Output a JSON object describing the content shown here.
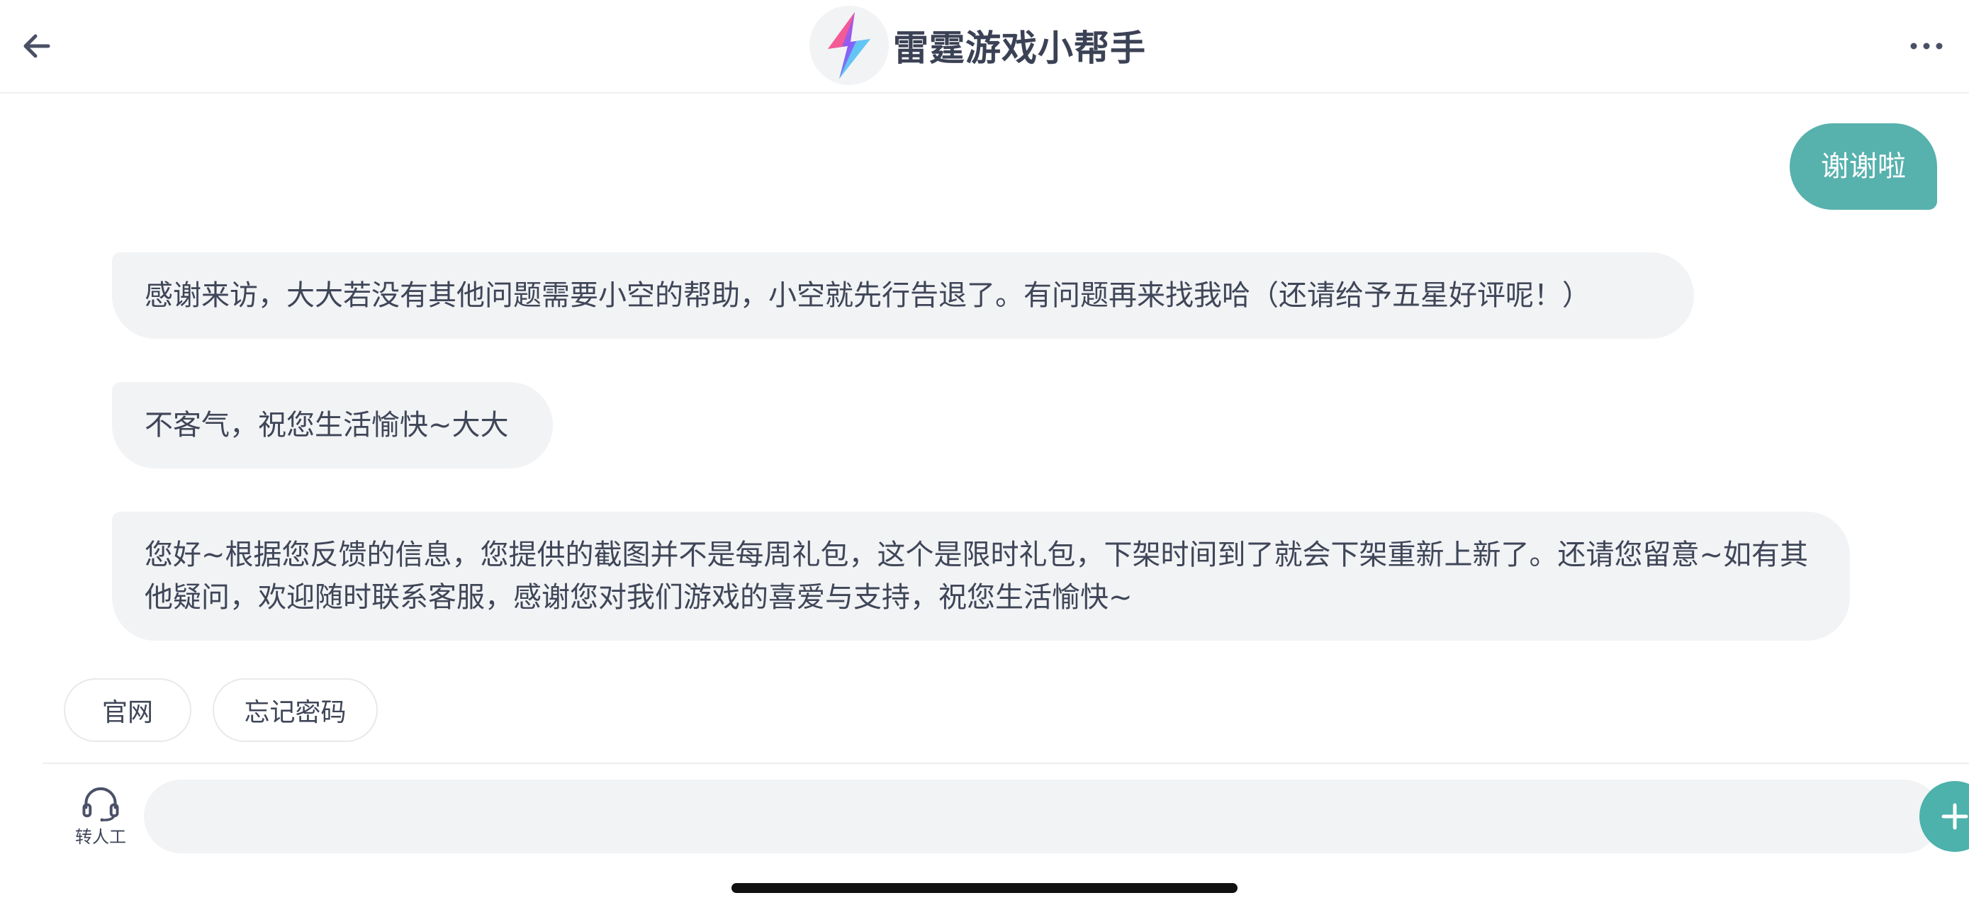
{
  "header": {
    "title": "雷霆游戏小帮手",
    "back_icon": "arrow-left-icon",
    "more_icon": "ellipsis-icon",
    "logo_icon": "thunder-logo-icon"
  },
  "messages": [
    {
      "sender": "user",
      "text": "谢谢啦"
    },
    {
      "sender": "bot",
      "text": "感谢来访，大大若没有其他问题需要小空的帮助，小空就先行告退了。有问题再来找我哈（还请给予五星好评呢！）"
    },
    {
      "sender": "bot",
      "text": "不客气，祝您生活愉快~大大"
    },
    {
      "sender": "bot",
      "text": "您好~根据您反馈的信息，您提供的截图并不是每周礼包，这个是限时礼包，下架时间到了就会下架重新上新了。还请您留意~如有其他疑问，欢迎随时联系客服，感谢您对我们游戏的喜爱与支持，祝您生活愉快~"
    }
  ],
  "quick_replies": [
    "官网",
    "忘记密码"
  ],
  "input_bar": {
    "agent_label": "转人工",
    "agent_icon": "headset-icon",
    "input_value": "",
    "plus_icon": "plus-icon"
  },
  "colors": {
    "accent": "#57b1ad",
    "bubble_bot": "#f2f3f5",
    "text": "#3f4658"
  }
}
